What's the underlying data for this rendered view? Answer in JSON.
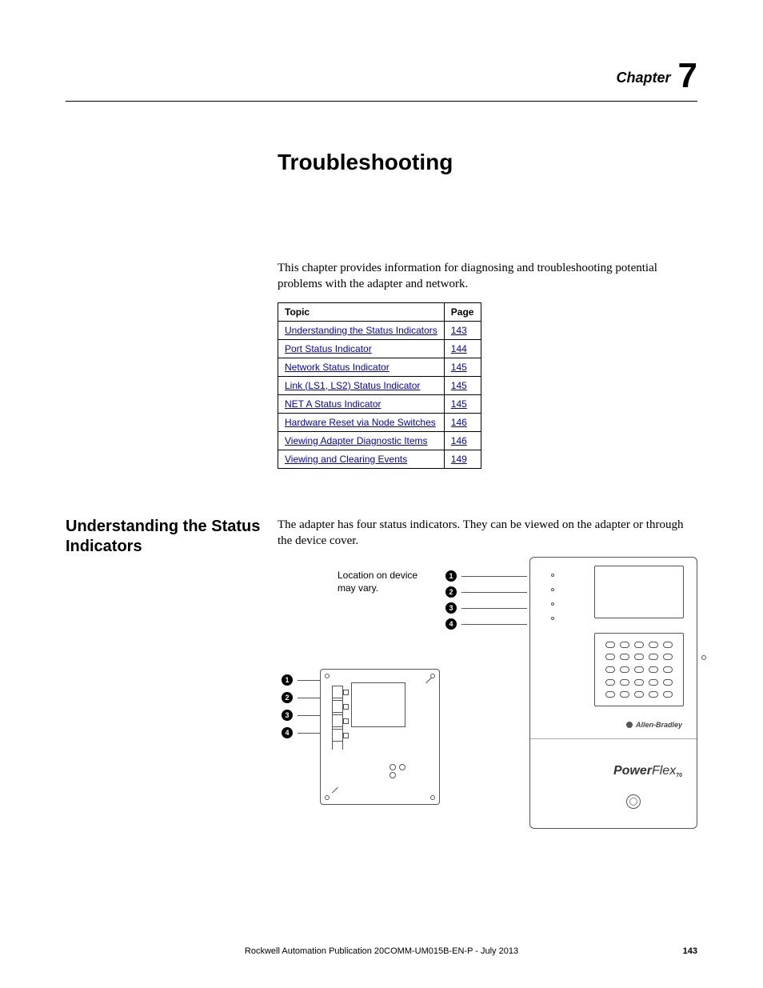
{
  "chapter_label": "Chapter",
  "chapter_number": "7",
  "main_heading": "Troubleshooting",
  "intro": "This chapter provides information for diagnosing and troubleshooting potential problems with the adapter and network.",
  "table": {
    "headers": {
      "topic": "Topic",
      "page": "Page"
    },
    "rows": [
      {
        "topic": "Understanding the Status Indicators",
        "page": "143"
      },
      {
        "topic": "Port Status Indicator",
        "page": "144"
      },
      {
        "topic": "Network Status Indicator",
        "page": "145"
      },
      {
        "topic": "Link (LS1, LS2) Status Indicator",
        "page": "145"
      },
      {
        "topic": "NET A Status Indicator",
        "page": "145"
      },
      {
        "topic": "Hardware Reset via Node Switches",
        "page": "146"
      },
      {
        "topic": "Viewing Adapter Diagnostic Items",
        "page": "146"
      },
      {
        "topic": "Viewing and Clearing Events",
        "page": "149"
      }
    ]
  },
  "section": {
    "heading": "Understanding the Status Indicators",
    "body": "The adapter has four status indicators. They can be viewed on the adapter or through the device cover."
  },
  "diagram": {
    "location_note_l1": "Location on device",
    "location_note_l2": "may vary.",
    "callouts": [
      "1",
      "2",
      "3",
      "4"
    ],
    "brand": "Allen-Bradley",
    "product_strong": "Power",
    "product_light": "Flex",
    "product_sub": "70"
  },
  "footer": {
    "publication": "Rockwell Automation Publication 20COMM-UM015B-EN-P - July 2013",
    "page": "143"
  }
}
